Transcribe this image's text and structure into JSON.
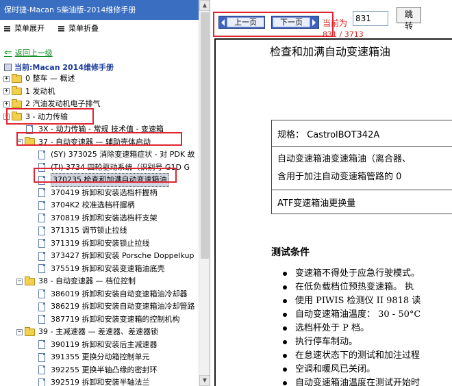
{
  "window_title": "保时捷-Macan S柴油版-2014维修手册",
  "menu": {
    "expand_label": "菜单展开",
    "collapse_label": "菜单折叠"
  },
  "back_label": "返回上一级",
  "current_label": "当前:Macan 2014维修手册",
  "tree": [
    {
      "label": "0 整车 — 概述",
      "type": "folder",
      "expanded": false
    },
    {
      "label": "1 发动机",
      "type": "folder",
      "expanded": false
    },
    {
      "label": "2 汽油发动机电子排气",
      "type": "folder",
      "expanded": false
    },
    {
      "label": "3 - 动力传输",
      "type": "folder",
      "expanded": true
    },
    {
      "label": "3X - 动力传输 - 常规 技术值 - 变速箱",
      "type": "doc"
    },
    {
      "label": "37 - 自动变速器 — 辅助壳体启动",
      "type": "folder",
      "expanded": true
    },
    {
      "label": "(SY) 373025 消除变速箱症状 - 对 PDK 故",
      "type": "doc"
    },
    {
      "label": "(TI) 3734 四轮驱动系统（识别号 G1D G",
      "type": "doc"
    },
    {
      "label": "370235 检查和加满自动变速箱油",
      "type": "doc",
      "selected": true
    },
    {
      "label": "370419 拆卸和安装选档杆握柄",
      "type": "doc"
    },
    {
      "label": "3704K2 校准选档杆握柄",
      "type": "doc"
    },
    {
      "label": "370819 拆卸和安装选档杆支架",
      "type": "doc"
    },
    {
      "label": "371315 调节锁止拉线",
      "type": "doc"
    },
    {
      "label": "371319 拆卸和安装锁止拉线",
      "type": "doc"
    },
    {
      "label": "373427 拆卸和安装 Porsche Doppelkup",
      "type": "doc"
    },
    {
      "label": "375519 拆卸和安装变速箱油底壳",
      "type": "doc"
    },
    {
      "label": "38 - 自动变速器 — 档位控制",
      "type": "folder",
      "expanded": true
    },
    {
      "label": "386019 拆卸和安装自动变速箱油冷却器",
      "type": "doc"
    },
    {
      "label": "386219 拆卸和安装自动变速箱油冷却管路",
      "type": "doc"
    },
    {
      "label": "387719 拆卸和安装变速箱的控制机构",
      "type": "doc"
    },
    {
      "label": "39 - 主减速器 — 差速器、差速器锁",
      "type": "folder",
      "expanded": true
    },
    {
      "label": "390119 拆卸和安装后主减速器",
      "type": "doc"
    },
    {
      "label": "391355 更换分动箱控制单元",
      "type": "doc"
    },
    {
      "label": "392255 更换半轴凸缘的密封环",
      "type": "doc"
    },
    {
      "label": "392519 拆卸和安装半轴法兰",
      "type": "doc"
    }
  ],
  "nav": {
    "prev_label": "上一页",
    "next_label": "下一页",
    "goto_label": "当前为",
    "page_value": "831",
    "goto_button": "跳转",
    "page_counter": "831 / 3713"
  },
  "document": {
    "title": "检查和加满自动变速箱油",
    "spec_row1": "规格：  CastrolBOT342A",
    "spec_row2_line1": "自动变速箱油变速箱油（离合器、",
    "spec_row2_line2": "含用于加注自动变速箱管路的 0",
    "spec_row3": "ATF变速箱油更换量",
    "conditions_heading": "测试条件",
    "conditions": [
      "变速箱不得处于应急行驶模式。",
      "在低负载档位预热变速箱。  执",
      "使用  PIWIS 检测仪  II 9818 读",
      "自动变速箱油温度：  30 - 50°C",
      "选档杆处于  P 档。",
      "执行停车制动。",
      "在怠速状态下的测试和加注过程",
      "空调和暖风已关闭。",
      "自动变速箱油温度在测试开始时"
    ]
  },
  "colors": {
    "title_bar": "#3a6ec0",
    "annotation": "#e0242f",
    "nav_button": "#3b63c2",
    "link_green": "#0a8a20"
  }
}
